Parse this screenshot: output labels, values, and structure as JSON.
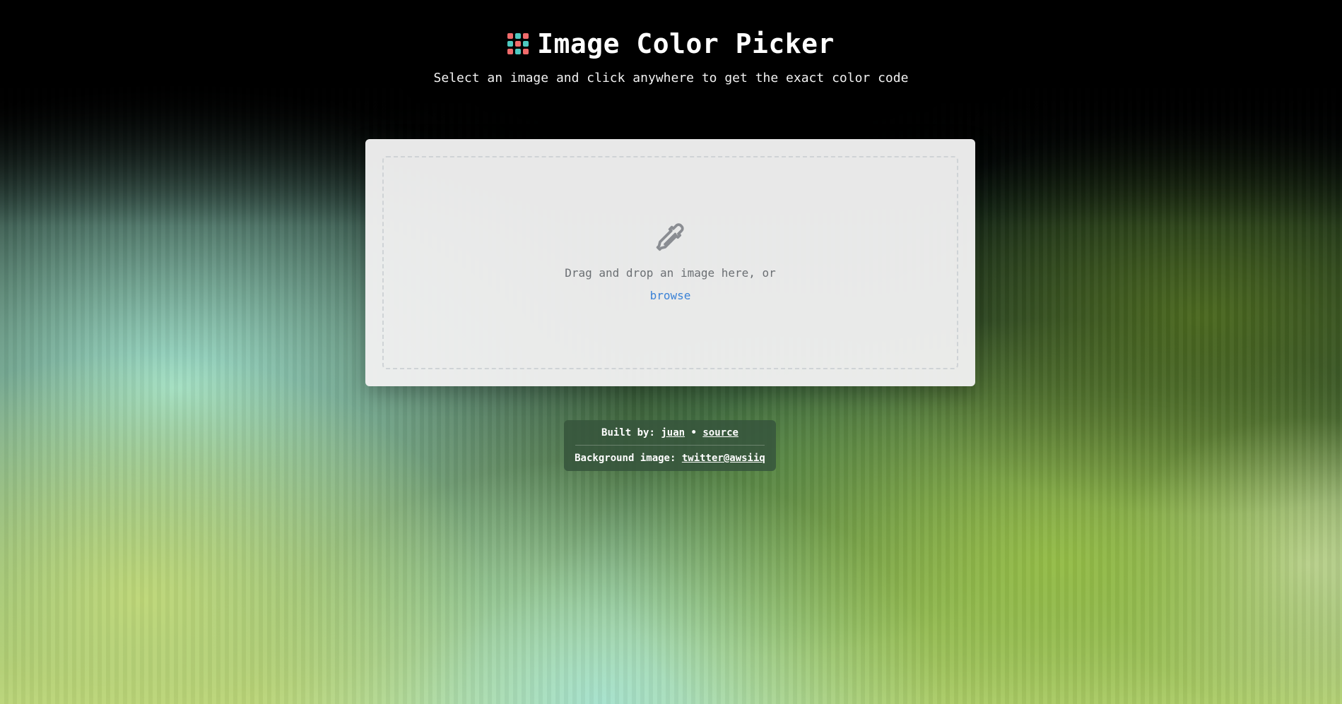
{
  "header": {
    "title": "Image Color Picker",
    "subtitle": "Select an image and click anywhere to get the exact color code",
    "logo_icon": "color-grid-icon",
    "logo_colors": [
      "#f06b6b",
      "#4ec9c0"
    ]
  },
  "dropzone": {
    "icon": "eyedropper-icon",
    "drop_text": "Drag and drop an image here, or",
    "browse_label": "browse",
    "link_color": "#3b82d6"
  },
  "footer": {
    "built_by_prefix": "Built by: ",
    "author_link": "juan",
    "separator": " • ",
    "source_link": "source",
    "background_prefix": "Background image: ",
    "background_link": "twitter@awsiiq"
  }
}
